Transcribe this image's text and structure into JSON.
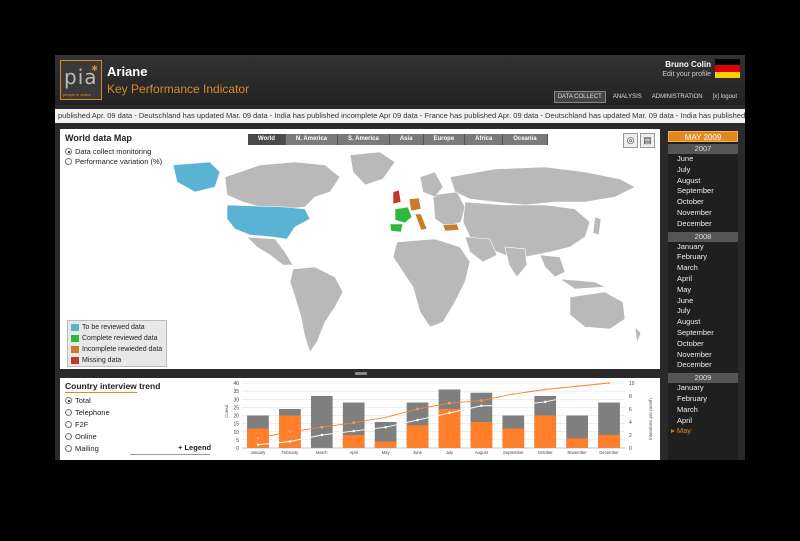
{
  "header": {
    "logo_text": "pia",
    "logo_subtext": "people in action",
    "app_name": "Ariane",
    "app_subtitle": "Key Performance Indicator",
    "user_name": "Bruno Colin",
    "edit_profile": "Edit your profile",
    "flag_colors": [
      "#000000",
      "#dd0000",
      "#ffce00"
    ],
    "nav": [
      {
        "label": "DATA COLLECT",
        "active": true
      },
      {
        "label": "ANALYSIS",
        "active": false
      },
      {
        "label": "ADMINISTRATION",
        "active": false
      },
      {
        "label": "[x] logout",
        "active": false
      }
    ]
  },
  "ticker": {
    "text": "published Apr. 09 data  -  Deutschland has updated Mar. 09 data  -  India has published incomplete Apr 09 data  -  France has published Apr. 09 data  -  Deutschland has updated Mar. 09 data  -  India has published incomple"
  },
  "map": {
    "title": "World data Map",
    "regions": [
      "World",
      "N. America",
      "S. America",
      "Asia",
      "Europe",
      "Africa",
      "Oceania"
    ],
    "selected_region": "World",
    "view_options": [
      {
        "label": "Data collect monitoring",
        "selected": true
      },
      {
        "label": "Performance variation (%)",
        "selected": false
      }
    ],
    "icons": [
      "globe-icon",
      "table-icon"
    ],
    "legend": [
      {
        "label": "To be reviewed data",
        "color": "#5bb3d4"
      },
      {
        "label": "Complete reviewed data",
        "color": "#2fb83d"
      },
      {
        "label": "Incomplete rewieded data",
        "color": "#c97a2a"
      },
      {
        "label": "Missing data",
        "color": "#c0392b"
      }
    ],
    "land_color": "#b9b9b9"
  },
  "calendar": {
    "selected_label": "MAY 2009",
    "groups": [
      {
        "year": "2007",
        "months": [
          "June",
          "July",
          "August",
          "September",
          "October",
          "November",
          "December"
        ]
      },
      {
        "year": "2008",
        "months": [
          "January",
          "February",
          "March",
          "April",
          "May",
          "June",
          "July",
          "August",
          "September",
          "October",
          "November",
          "December"
        ]
      },
      {
        "year": "2009",
        "months": [
          "January",
          "February",
          "March",
          "April",
          "May"
        ]
      }
    ],
    "selected_month": "May",
    "selected_year": "2009"
  },
  "trend": {
    "title": "Country interview trend",
    "options": [
      {
        "label": "Total",
        "selected": true
      },
      {
        "label": "Telephone",
        "selected": false
      },
      {
        "label": "F2F",
        "selected": false
      },
      {
        "label": "Online",
        "selected": false
      },
      {
        "label": "Mailing",
        "selected": false
      }
    ],
    "legend_label": "Legend"
  },
  "chart_data": {
    "type": "bar",
    "categories": [
      "January",
      "February",
      "March",
      "April",
      "May",
      "June",
      "July",
      "August",
      "September",
      "October",
      "November",
      "December"
    ],
    "ylim": [
      0,
      40
    ],
    "yticks": [
      "0",
      "5",
      "10",
      "15",
      "20",
      "25",
      "30",
      "35",
      "40"
    ],
    "y2lim": [
      0,
      10
    ],
    "y2ticks": [
      "0",
      "2",
      "4",
      "6",
      "8",
      "10"
    ],
    "y2label": "Interviews per month",
    "ylabel": "Cumul",
    "series": [
      {
        "values": [
          20,
          24,
          32,
          28,
          16,
          28,
          36,
          34,
          20,
          32,
          20,
          28
        ],
        "color": "#7f7f7f"
      },
      {
        "values": [
          12,
          20,
          0,
          8,
          4,
          14,
          24,
          16,
          12,
          20,
          6,
          8
        ],
        "color": "#ff7f2a"
      },
      {
        "values": [
          1.5,
          2.5,
          3.2,
          3.9,
          4.7,
          6.0,
          6.9,
          7.3,
          8.3,
          9.0,
          9.5,
          10.0
        ],
        "color": "#ff7f2a",
        "axis": "right",
        "kind": "line"
      },
      {
        "values": [
          0.5,
          1.0,
          2.0,
          2.6,
          3.2,
          4.3,
          5.4,
          6.5,
          6.5,
          7.1,
          8.1,
          9.4
        ],
        "color": "#ffffff",
        "axis": "right",
        "kind": "line"
      }
    ]
  }
}
